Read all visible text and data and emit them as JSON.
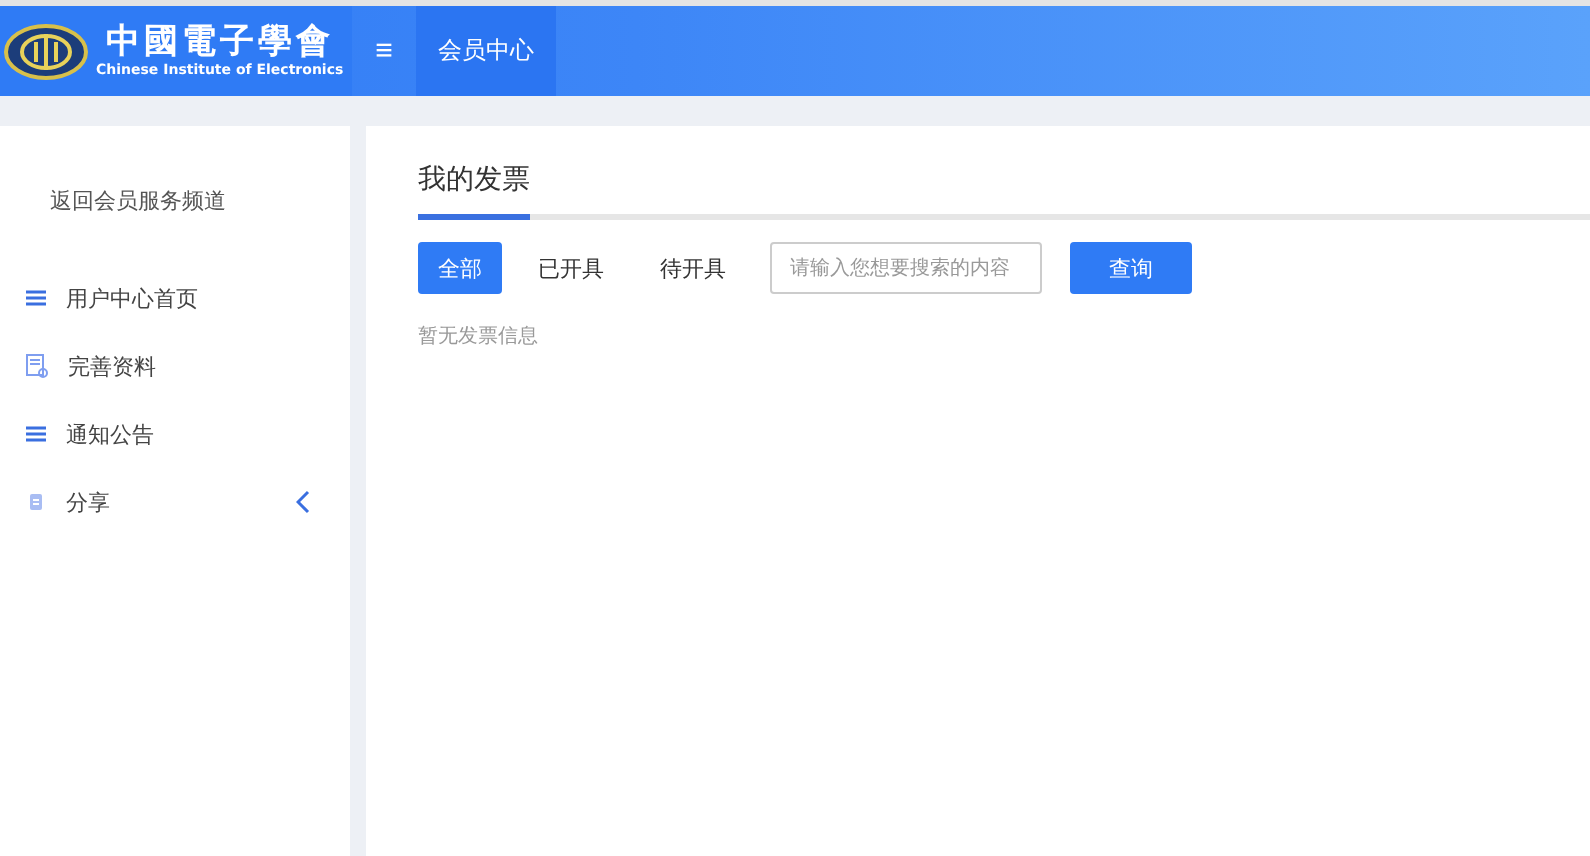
{
  "header": {
    "logo_title": "中國電子學會",
    "logo_subtitle": "Chinese Institute of Electronics",
    "menu_icon": "≡",
    "nav": [
      {
        "label": "会员中心",
        "selected": true
      }
    ]
  },
  "sidebar": {
    "back_link": "返回会员服务频道",
    "items": [
      {
        "label": "用户中心首页",
        "kind": "list"
      },
      {
        "label": "完善资料",
        "kind": "form"
      },
      {
        "label": "通知公告",
        "kind": "list"
      },
      {
        "label": "分享",
        "kind": "share",
        "expandable": true
      }
    ]
  },
  "main": {
    "title": "我的发票",
    "filters": [
      {
        "label": "全部",
        "selected": true
      },
      {
        "label": "已开具",
        "selected": false
      },
      {
        "label": "待开具",
        "selected": false
      }
    ],
    "search": {
      "placeholder": "请输入您想要搜索的内容"
    },
    "search_button": "查询",
    "empty_message": "暂无发票信息"
  }
}
